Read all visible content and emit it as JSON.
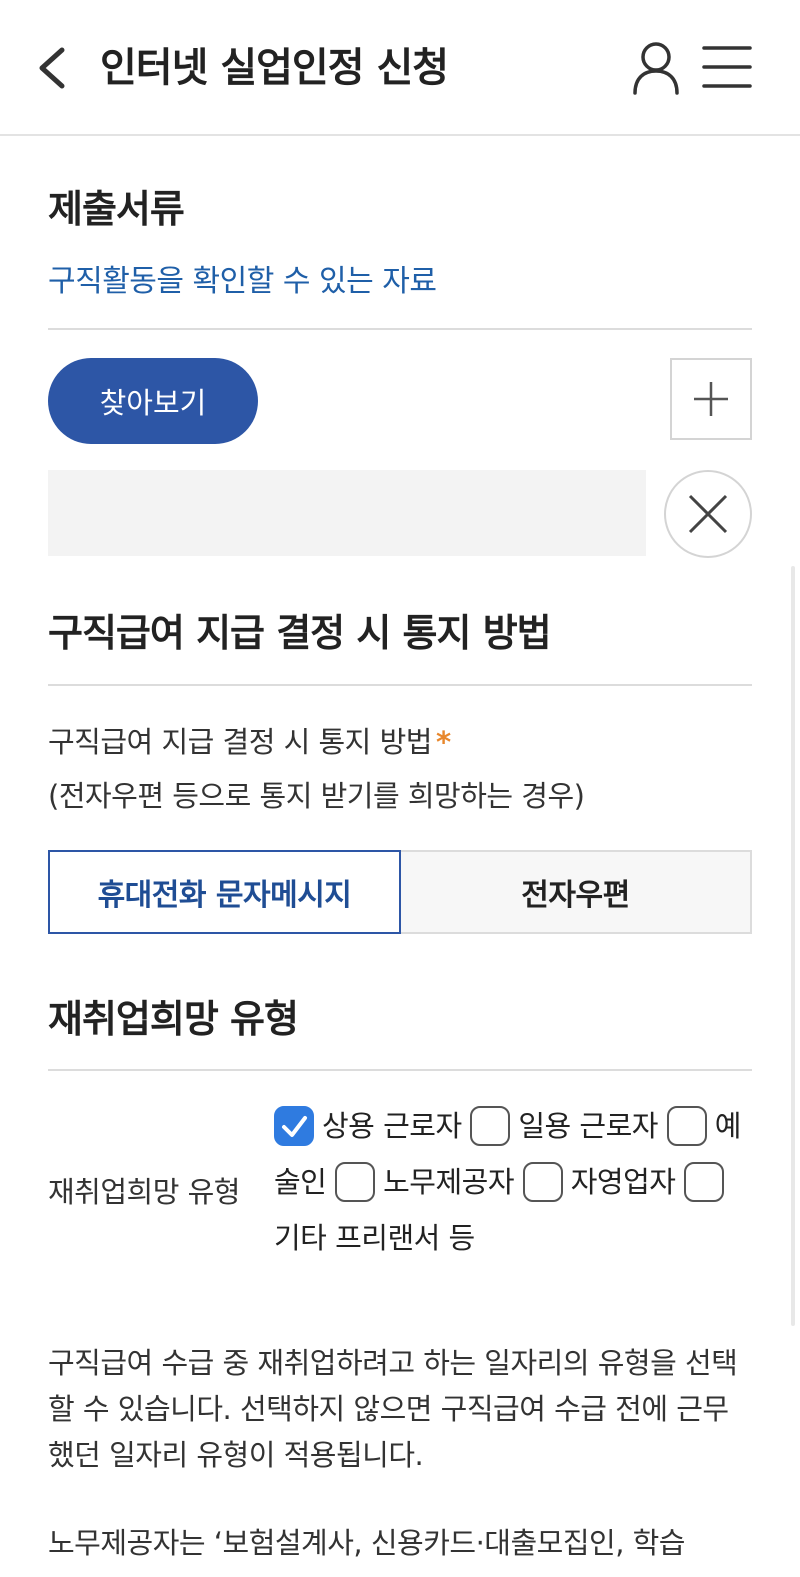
{
  "header": {
    "title": "인터넷 실업인정 신청"
  },
  "documents": {
    "title": "제출서류",
    "subtitle": "구직활동을 확인할 수 있는 자료",
    "browse_label": "찾아보기"
  },
  "notification": {
    "title": "구직급여 지급 결정 시 통지 방법",
    "label": "구직급여 지급 결정 시 통지 방법",
    "required_mark": "*",
    "hint": "(전자우편 등으로 통지 받기를 희망하는 경우)",
    "options": [
      "휴대전화 문자메시지",
      "전자우편"
    ],
    "selected": "휴대전화 문자메시지"
  },
  "reemployment": {
    "title": "재취업희망 유형",
    "label": "재취업희망 유형",
    "options": [
      {
        "label": "상용 근로자",
        "checked": true
      },
      {
        "label": "일용 근로자",
        "checked": false
      },
      {
        "label": "예술인",
        "checked": false
      },
      {
        "label": "노무제공자",
        "checked": false
      },
      {
        "label": "자영업자",
        "checked": false
      },
      {
        "label": "기타 프리랜서 등",
        "checked": false
      }
    ],
    "description": "구직급여 수급 중 재취업하려고 하는 일자리의 유형을 선택할 수 있습니다. 선택하지 않으면 구직급여 수급 전에 근무했던 일자리 유형이 적용됩니다.",
    "description2": "노무제공자는 ‘보험설계사, 신용카드·대출모집인, 학습"
  },
  "colors": {
    "primary": "#2d56a6",
    "link": "#1f5fa8",
    "required": "#e8872c",
    "checkbox_checked": "#2f7be0"
  }
}
